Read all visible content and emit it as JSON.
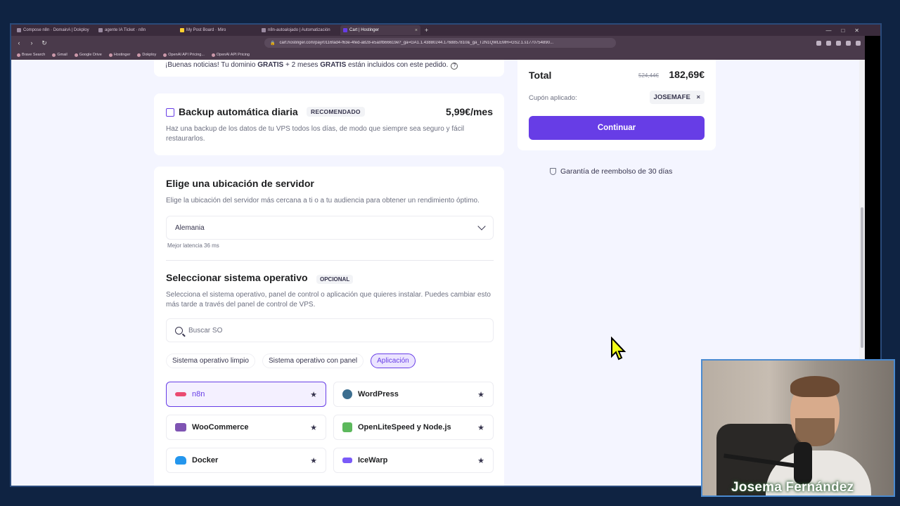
{
  "browser": {
    "tabs": [
      {
        "label": "Compose n8n · DomainA | Dokploy",
        "active": false
      },
      {
        "label": "agente IA Ticket · n8n",
        "active": false
      },
      {
        "label": "My Post Board · Miro",
        "active": false
      },
      {
        "label": "n8n-autoalojado | Automatización",
        "active": false
      },
      {
        "label": "Cart | Hostinger",
        "active": true
      }
    ],
    "url": "cart.hostinger.com/pay/0116fad4-f63e-4fed-a828-e5a0fb66619e?_ga=GA1.1.43880244.1768857810&_ga_T2N1QWLEMH=GS2.1.s1770754890...",
    "bookmarks": [
      "Brave Search",
      "Gmail",
      "Google Drive",
      "Hostinger",
      "Dokploy",
      "OpenAI API Pricing...",
      "OpenAI API Pricing"
    ]
  },
  "promo": {
    "prefix": "¡Buenas noticias! Tu dominio ",
    "free1": "GRATIS",
    "middle": " + 2 meses ",
    "free2": "GRATIS",
    "suffix": " están incluidos con este pedido."
  },
  "backup": {
    "title": "Backup automática diaria",
    "badge": "RECOMENDADO",
    "price": "5,99€/mes",
    "description": "Haz una backup de los datos de tu VPS todos los días, de modo que siempre sea seguro y fácil restaurarlos."
  },
  "location": {
    "title": "Elige una ubicación de servidor",
    "subtitle": "Elige la ubicación del servidor más cercana a ti o a tu audiencia para obtener un rendimiento óptimo.",
    "selected": "Alemania",
    "latency": "Mejor latencia 36 ms"
  },
  "os": {
    "title": "Seleccionar sistema operativo",
    "badge": "OPCIONAL",
    "subtitle": "Selecciona el sistema operativo, panel de control o aplicación que quieres instalar. Puedes cambiar esto más tarde a través del panel de control de VPS.",
    "search_placeholder": "Buscar SO",
    "chips": [
      {
        "label": "Sistema operativo limpio",
        "active": false
      },
      {
        "label": "Sistema operativo con panel",
        "active": false
      },
      {
        "label": "Aplicación",
        "active": true
      }
    ],
    "apps": [
      {
        "label": "n8n",
        "selected": true,
        "logo_color": "#ea4b71"
      },
      {
        "label": "WordPress",
        "selected": false,
        "logo_color": "#3c6e8f"
      },
      {
        "label": "WooCommerce",
        "selected": false,
        "logo_color": "#7f54b3"
      },
      {
        "label": "OpenLiteSpeed y Node.js",
        "selected": false,
        "logo_color": "#5cb85c"
      },
      {
        "label": "Docker",
        "selected": false,
        "logo_color": "#2496ed"
      },
      {
        "label": "IceWarp",
        "selected": false,
        "logo_color": "#7a5af8"
      }
    ]
  },
  "summary": {
    "total_label": "Total",
    "old_price": "524,44€",
    "total": "182,69€",
    "coupon_label": "Cupón aplicado:",
    "coupon_code": "JOSEMAFE",
    "coupon_remove": "×",
    "continue_label": "Continuar",
    "guarantee": "Garantía de reembolso de 30 días"
  },
  "presenter": {
    "name": "Josema Fernández"
  },
  "colors": {
    "accent": "#673de6",
    "page_bg": "#f4f5ff",
    "outer_bg": "#0f2342"
  }
}
